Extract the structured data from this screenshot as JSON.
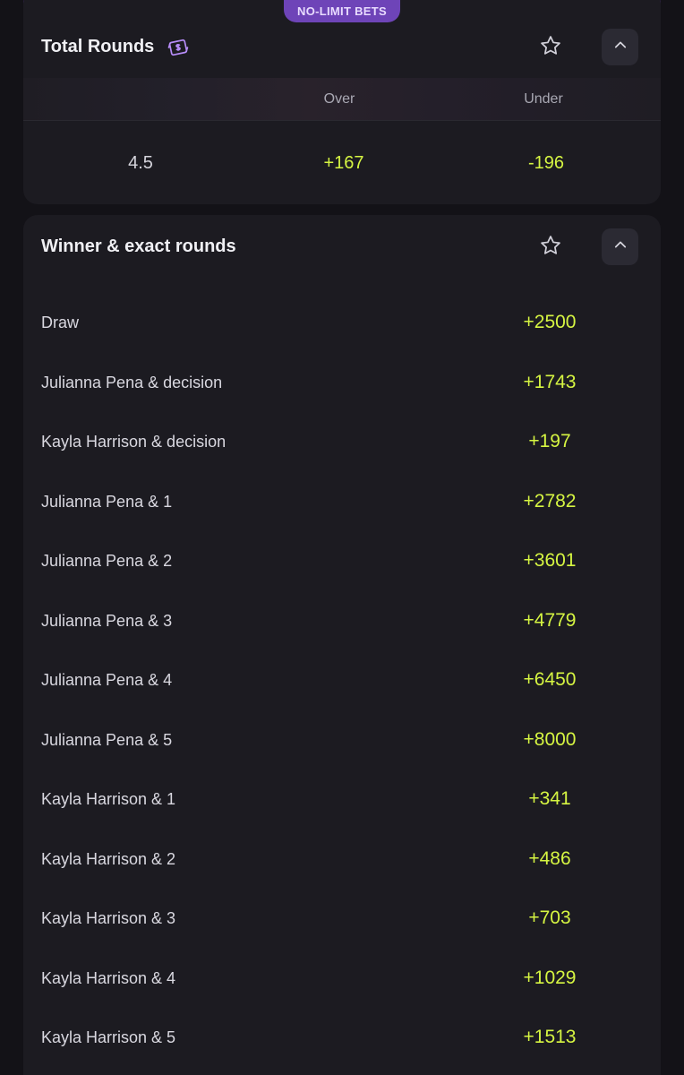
{
  "total_rounds": {
    "promo_tab": "NO-LIMIT BETS",
    "title": "Total Rounds",
    "icons": {
      "promo": "money-bill-icon",
      "favorite": "star-icon",
      "collapse": "chevron-up-icon"
    },
    "headers": {
      "over": "Over",
      "under": "Under"
    },
    "line": "4.5",
    "over_odds": "+167",
    "under_odds": "-196"
  },
  "winner_exact_rounds": {
    "title": "Winner & exact rounds",
    "icons": {
      "favorite": "star-icon",
      "collapse": "chevron-up-icon"
    },
    "rows": [
      {
        "label": "Draw",
        "odds": "+2500"
      },
      {
        "label": "Julianna Pena & decision",
        "odds": "+1743"
      },
      {
        "label": "Kayla Harrison & decision",
        "odds": "+197"
      },
      {
        "label": "Julianna Pena & 1",
        "odds": "+2782"
      },
      {
        "label": "Julianna Pena & 2",
        "odds": "+3601"
      },
      {
        "label": "Julianna Pena & 3",
        "odds": "+4779"
      },
      {
        "label": "Julianna Pena & 4",
        "odds": "+6450"
      },
      {
        "label": "Julianna Pena & 5",
        "odds": "+8000"
      },
      {
        "label": "Kayla Harrison & 1",
        "odds": "+341"
      },
      {
        "label": "Kayla Harrison & 2",
        "odds": "+486"
      },
      {
        "label": "Kayla Harrison & 3",
        "odds": "+703"
      },
      {
        "label": "Kayla Harrison & 4",
        "odds": "+1029"
      },
      {
        "label": "Kayla Harrison & 5",
        "odds": "+1513"
      }
    ]
  },
  "colors": {
    "background": "#131217",
    "card": "#1c1b21",
    "accent_purple": "#6e44b8",
    "odds_green": "#d6f542",
    "text": "#d9d8e0",
    "muted": "#a9a8b3"
  }
}
